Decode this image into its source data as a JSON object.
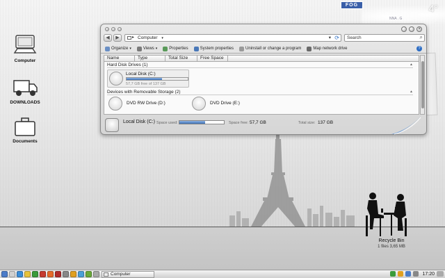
{
  "desktop": {
    "icons": [
      {
        "label": "Computer"
      },
      {
        "label": "DOWNLOADS"
      },
      {
        "label": "Documents"
      }
    ],
    "recycle_bin": {
      "label": "Recycle Bin",
      "info": "1 files 3,65 MB"
    }
  },
  "widget": {
    "badge": "FOG",
    "location": "NNA . G",
    "temperature": "4°"
  },
  "window": {
    "address": "Computer",
    "search_placeholder": "Search",
    "toolbar": [
      {
        "label": "Organize",
        "icon": "organize-icon"
      },
      {
        "label": "Views",
        "icon": "views-icon"
      },
      {
        "label": "Properties",
        "icon": "properties-icon"
      },
      {
        "label": "System properties",
        "icon": "system-properties-icon"
      },
      {
        "label": "Uninstall or change a program",
        "icon": "uninstall-icon"
      },
      {
        "label": "Map network drive",
        "icon": "map-drive-icon"
      }
    ],
    "columns": [
      "Name",
      "Type",
      "Total Size",
      "Free Space"
    ],
    "groups": [
      {
        "title": "Hard Disk Drives (1)"
      },
      {
        "title": "Devices with Removable Storage (2)"
      }
    ],
    "hard_disks": [
      {
        "name": "Local Disk (C:)",
        "free_text": "57,7 GB free of 137 GB",
        "used_fraction": 0.58
      }
    ],
    "removable": [
      {
        "name": "DVD RW Drive (D:)"
      },
      {
        "name": "DVD Drive (E:)"
      }
    ],
    "details": {
      "name": "Local Disk (C:)",
      "space_used_label": "Space used:",
      "space_free_label": "Space free:",
      "space_free": "57,7 GB",
      "total_size_label": "Total size:",
      "total_size": "137 GB",
      "used_fraction": 0.58
    }
  },
  "taskbar": {
    "task_label": "Computer",
    "clock": "17:20"
  },
  "colors": {
    "accent": "#3c6fb3",
    "taskbar": "#d8d8d8"
  }
}
